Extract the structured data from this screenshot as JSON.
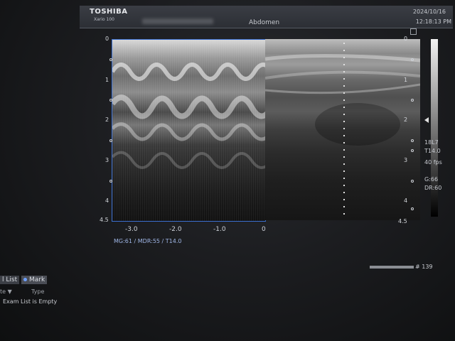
{
  "header": {
    "brand": "TOSHIBA",
    "model": "Xario 100",
    "exam": "Abdomen",
    "date": "2024/10/16",
    "time": "12:18:13 PM"
  },
  "image": {
    "depth_labels_left": [
      "0",
      "1",
      "2",
      "3",
      "4",
      "4.5"
    ],
    "depth_labels_right": [
      "0",
      "1",
      "2",
      "3",
      "4",
      "4.5"
    ],
    "time_axis_labels": [
      "-3.0",
      "-2.0",
      "-1.0",
      "0"
    ],
    "mmode_params": "MG:61   / MDR:55  / T14.0"
  },
  "side_info": {
    "probe": "18L7",
    "thi": "T14.0",
    "fps": "40 fps",
    "gain": "G:66",
    "dr": "DR:60"
  },
  "cine": {
    "frame_label": "# 139"
  },
  "exam_panel": {
    "tab_list": "l List",
    "tab_mark": "Mark",
    "col_date": "te ▼",
    "col_type": "Type",
    "empty_msg": "Exam List is Empty"
  },
  "colors": {
    "accent": "#3b6fd0",
    "param_text": "#9fb6e6"
  }
}
